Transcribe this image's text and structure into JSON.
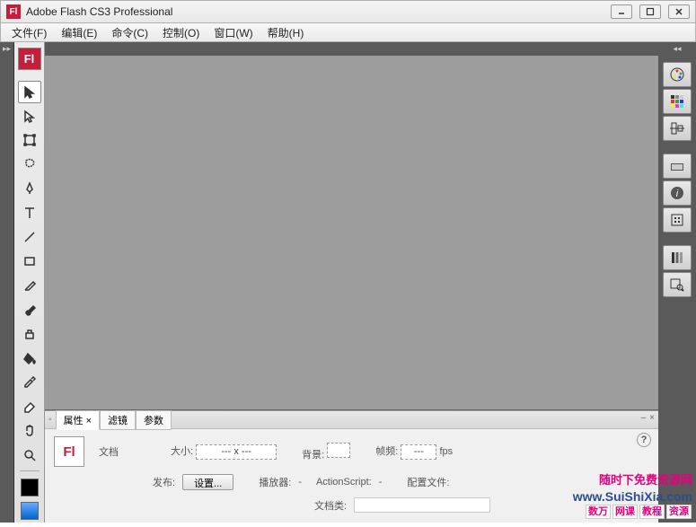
{
  "titlebar": {
    "icon_label": "Fl",
    "title": "Adobe Flash CS3 Professional"
  },
  "menu": {
    "items": [
      "文件(F)",
      "编辑(E)",
      "命令(C)",
      "控制(O)",
      "窗口(W)",
      "帮助(H)"
    ]
  },
  "toolbar": {
    "app_icon": "Fl",
    "tools": [
      "selection",
      "subselection",
      "free-transform",
      "lasso",
      "pen",
      "text",
      "line",
      "rectangle",
      "pencil",
      "brush",
      "ink-bottle",
      "paint-bucket",
      "eyedropper",
      "eraser",
      "hand",
      "zoom"
    ]
  },
  "properties": {
    "tabs": [
      "属性",
      "滤镜",
      "参数"
    ],
    "active_tab": 0,
    "doc_icon": "Fl",
    "doc_label": "文档",
    "size_label": "大小:",
    "size_value": "--- x ---",
    "bg_label": "背景:",
    "fps_label": "帧频:",
    "fps_value": "---",
    "fps_unit": "fps",
    "publish_label": "发布:",
    "settings_btn": "设置...",
    "player_label": "播放器:",
    "player_value": "-",
    "as_label": "ActionScript:",
    "as_value": "-",
    "profile_label": "配置文件:",
    "class_label": "文档类:"
  },
  "right_panels": [
    "color",
    "swatches",
    "align",
    "transform",
    "info",
    "library",
    "components",
    "component-inspector"
  ],
  "watermark": {
    "line1": "随时下免费资源网",
    "line2": "www.SuiShiXia.com",
    "line3_parts": [
      "数万",
      "网课",
      "教程",
      "资源"
    ]
  }
}
